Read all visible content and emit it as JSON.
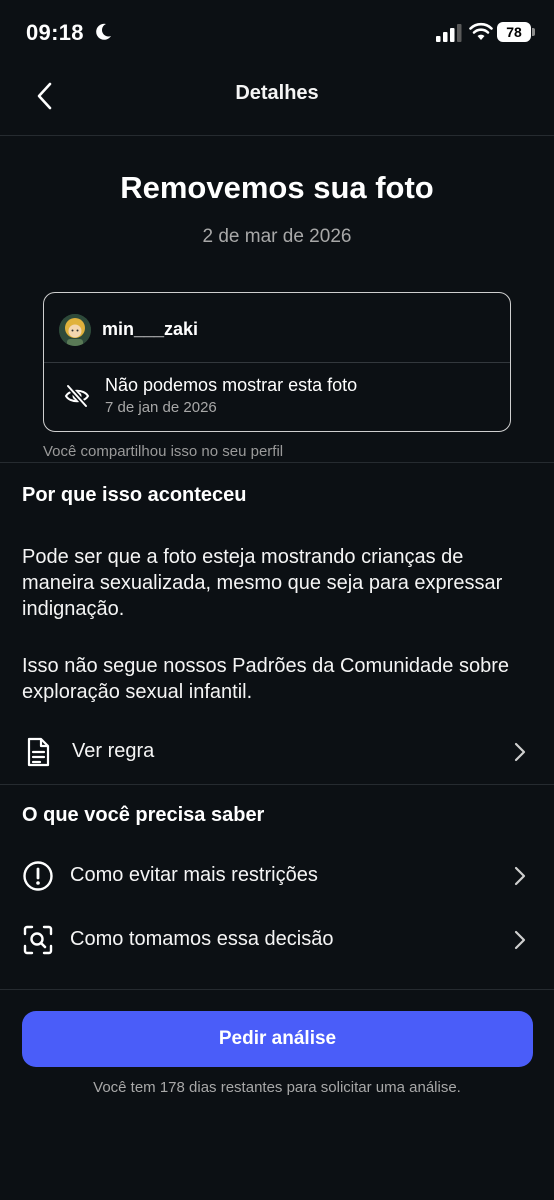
{
  "status_bar": {
    "time": "09:18",
    "battery": "78"
  },
  "nav": {
    "title": "Detalhes"
  },
  "header": {
    "headline": "Removemos sua foto",
    "date": "2 de mar de 2026"
  },
  "post_card": {
    "username": "min___zaki",
    "message": "Não podemos mostrar esta foto",
    "date": "7 de jan de 2026",
    "note": "Você compartilhou isso no seu perfil"
  },
  "why_section": {
    "title": "Por que isso aconteceu",
    "paragraph_1": "Pode ser que a foto esteja mostrando crianças de maneira sexualizada, mesmo que seja para expressar indignação.",
    "paragraph_2": "Isso não segue nossos Padrões da Comunidade sobre exploração sexual infantil.",
    "rule_link": "Ver regra"
  },
  "info_section": {
    "title": "O que você precisa saber",
    "items": [
      {
        "label": "Como evitar mais restrições",
        "icon": "exclamation-circle-icon"
      },
      {
        "label": "Como tomamos essa decisão",
        "icon": "magnify-scan-icon"
      }
    ]
  },
  "action": {
    "button_label": "Pedir análise",
    "note": "Você tem 178 dias restantes para solicitar uma análise."
  },
  "colors": {
    "background": "#0c1014",
    "accent": "#4a5df9",
    "secondary_text": "#a8a8a8"
  }
}
